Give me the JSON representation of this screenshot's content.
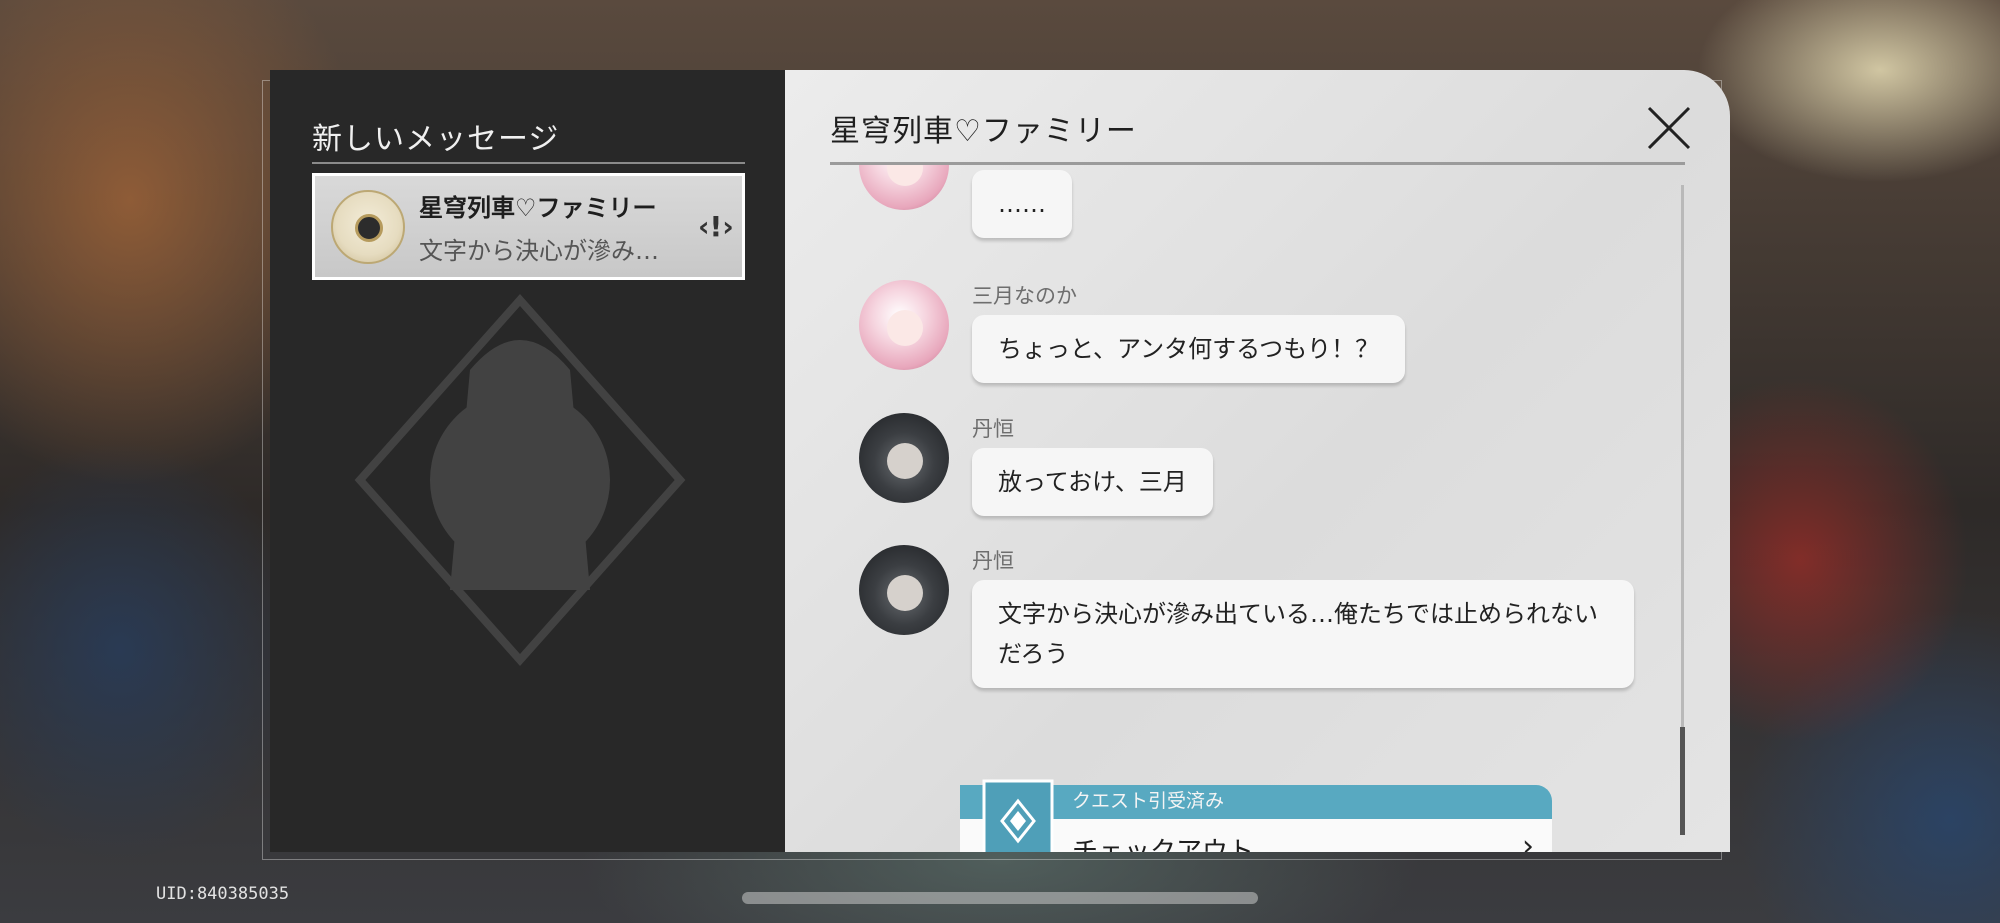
{
  "sidebar": {
    "title": "新しいメッセージ",
    "conversations": [
      {
        "name": "星穹列車♡ファミリー",
        "preview": "文字から決心が滲み…",
        "alert_icon": "exclamation-badge-icon"
      }
    ]
  },
  "chat": {
    "title": "星穹列車♡ファミリー",
    "close_icon": "close-x-icon",
    "messages": [
      {
        "sender": "",
        "avatar": "march-7th-avatar",
        "text": "……"
      },
      {
        "sender": "三月なのか",
        "avatar": "march-7th-avatar",
        "text": "ちょっと、アンタ何するつもり！？"
      },
      {
        "sender": "丹恒",
        "avatar": "dan-heng-avatar",
        "text": "放っておけ、三月"
      },
      {
        "sender": "丹恒",
        "avatar": "dan-heng-avatar",
        "text": "文字から決心が滲み出ている…俺たちでは止められないだろう"
      }
    ],
    "quest": {
      "status": "クエスト引受済み",
      "name": "チェックアウト",
      "icon": "quest-diamond-icon",
      "arrow_icon": "chevron-right-icon"
    }
  },
  "footer": {
    "uid": "UID:840385035"
  },
  "colors": {
    "left_panel": "#282828",
    "right_panel": "#e4e4e4",
    "quest_accent": "#58a9c1"
  }
}
